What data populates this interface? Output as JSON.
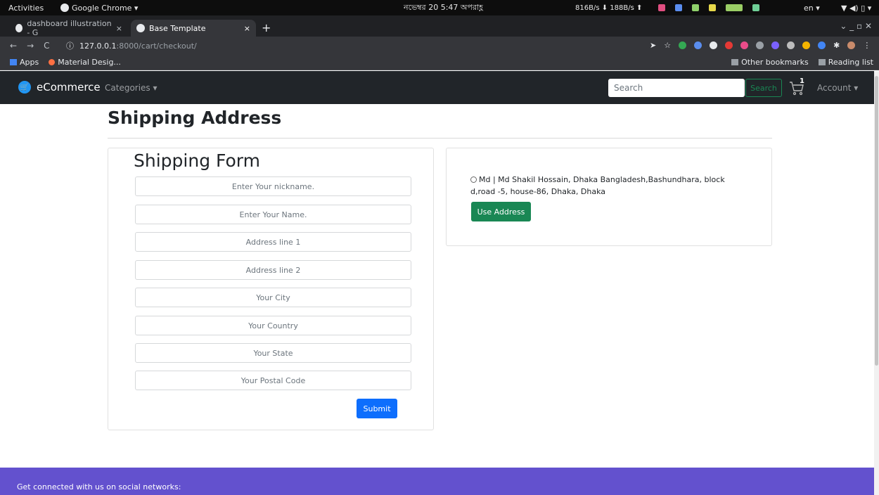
{
  "os_bar": {
    "activities": "Activities",
    "app_name": "Google Chrome ▾",
    "clock": "নভেম্বর 20  5:47 অপরাহ্ণ",
    "net_speed": "816B/s ⬇  188B/s ⬆",
    "language": "en ▾",
    "system_icons": "▼ ◀) ▯ ▾"
  },
  "browser": {
    "tabs": [
      {
        "title": "dashboard illustration - G",
        "close": "×"
      },
      {
        "title": "Base Template",
        "close": "×"
      }
    ],
    "new_tab": "+",
    "window_controls": "⌄   _   ▫   ✕",
    "nav": {
      "back": "←",
      "forward": "→",
      "reload": "C"
    },
    "url_host": "127.0.0.1",
    "url_path": ":8000/cart/checkout/",
    "bookmarks": {
      "apps": "Apps",
      "material": "Material Desig...",
      "other": "Other bookmarks",
      "reading": "Reading list"
    }
  },
  "navbar": {
    "brand": "eCommerce",
    "categories": "Categories ▾",
    "search_placeholder": "Search",
    "search_button": "Search",
    "cart_count": "1",
    "account": "Account ▾"
  },
  "page": {
    "title": "Shipping Address"
  },
  "shipping_form": {
    "title": "Shipping Form",
    "fields": [
      {
        "placeholder": "Enter Your nickname."
      },
      {
        "placeholder": "Enter Your Name."
      },
      {
        "placeholder": "Address line 1"
      },
      {
        "placeholder": "Address line 2"
      },
      {
        "placeholder": "Your City"
      },
      {
        "placeholder": "Your Country"
      },
      {
        "placeholder": "Your State"
      },
      {
        "placeholder": "Your Postal Code"
      }
    ],
    "submit": "Submit"
  },
  "saved_address": {
    "text": "Md | Md Shakil Hossain, Dhaka Bangladesh,Bashundhara, block d,road -5, house-86, Dhaka, Dhaka",
    "button": "Use Address"
  },
  "footer": {
    "text": "Get connected with us on social networks:"
  },
  "colors": {
    "navbar_bg": "#212529",
    "primary": "#0d6efd",
    "success": "#198754",
    "footer_bg": "#6351ce"
  }
}
